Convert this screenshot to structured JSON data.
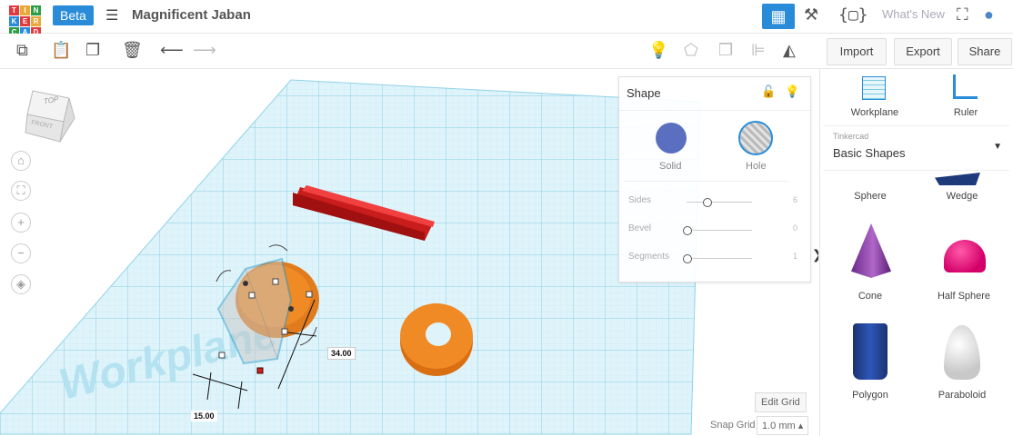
{
  "app": {
    "logo_letters": [
      "T",
      "I",
      "N",
      "K",
      "E",
      "R",
      "C",
      "A",
      "D"
    ],
    "logo_colors": [
      "#e03a3e",
      "#e9a83a",
      "#2b9d44",
      "#2a8cd9",
      "#e03a3e",
      "#e9a83a",
      "#2b9d44",
      "#2a8cd9",
      "#e03a3e"
    ],
    "beta_label": "Beta",
    "project_title": "Magnificent Jaban",
    "whats_new": "What's New"
  },
  "toolbar": {
    "import_label": "Import",
    "export_label": "Export",
    "share_label": "Share"
  },
  "viewcube": {
    "top": "TOP",
    "front": "FRONT"
  },
  "workplane_text": "Workplane",
  "dimensions": {
    "width": "15.00",
    "depth": "34.00"
  },
  "shape_panel": {
    "title": "Shape",
    "solid_label": "Solid",
    "hole_label": "Hole",
    "solid_color": "#5a6fc0",
    "props": [
      {
        "label": "Sides",
        "value": "6",
        "fraction": 0.55
      },
      {
        "label": "Bevel",
        "value": "0",
        "fraction": 0.0
      },
      {
        "label": "Segments",
        "value": "1",
        "fraction": 0.0
      }
    ]
  },
  "grid_controls": {
    "edit_grid": "Edit Grid",
    "snap_label": "Snap Grid",
    "snap_value": "1.0 mm ▴"
  },
  "library": {
    "workplane_label": "Workplane",
    "ruler_label": "Ruler",
    "category_caption": "Tinkercad",
    "category_value": "Basic Shapes",
    "shapes": [
      {
        "label": "Sphere"
      },
      {
        "label": "Wedge"
      },
      {
        "label": "Cone"
      },
      {
        "label": "Half Sphere"
      },
      {
        "label": "Polygon"
      },
      {
        "label": "Paraboloid"
      }
    ]
  },
  "colors": {
    "accent": "#2a8cd9",
    "grid": "#a9dced",
    "box": "#e02a2a",
    "orange": "#f08a24"
  }
}
